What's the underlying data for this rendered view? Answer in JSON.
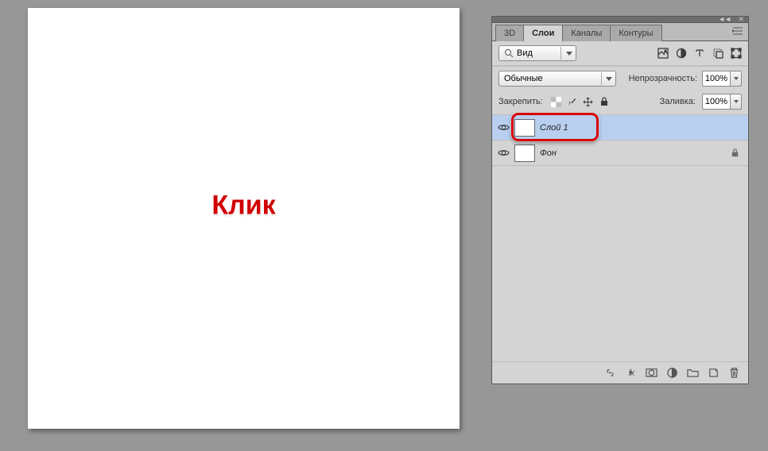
{
  "canvas": {
    "annotation": "Клик"
  },
  "tabs": {
    "t0": "3D",
    "t1": "Слои",
    "t2": "Каналы",
    "t3": "Контуры"
  },
  "filter": {
    "label": "Вид"
  },
  "blend": {
    "label": "Обычные"
  },
  "opacity": {
    "label": "Непрозрачность:",
    "value": "100%"
  },
  "fill": {
    "lockLabel": "Закрепить:",
    "label": "Заливка:",
    "value": "100%"
  },
  "layers": {
    "l0": {
      "name": "Слой 1"
    },
    "l1": {
      "name": "Фон"
    }
  }
}
